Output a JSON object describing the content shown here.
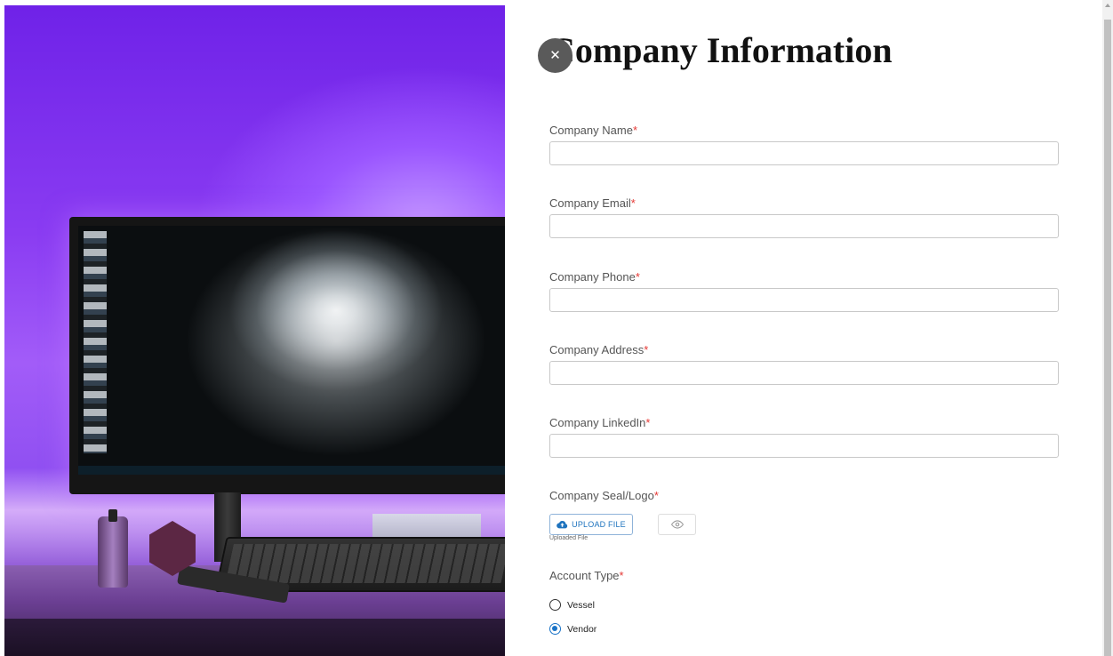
{
  "form": {
    "title": "Company Information",
    "close_icon": "close-icon",
    "required_mark": "*",
    "fields": [
      {
        "label": "Company Name",
        "value": "",
        "placeholder": ""
      },
      {
        "label": "Company Email",
        "value": "",
        "placeholder": ""
      },
      {
        "label": "Company Phone",
        "value": "",
        "placeholder": ""
      },
      {
        "label": "Company Address",
        "value": "",
        "placeholder": ""
      },
      {
        "label": "Company LinkedIn",
        "value": "",
        "placeholder": ""
      }
    ],
    "logo": {
      "label": "Company Seal/Logo",
      "upload_label": "UPLOAD FILE",
      "upload_icon": "cloud-upload-icon",
      "preview_icon": "eye-icon",
      "uploaded_note": "Uploaded File"
    },
    "account_type": {
      "label": "Account Type",
      "options": [
        "Vessel",
        "Vendor"
      ],
      "selected": "Vendor"
    }
  },
  "colors": {
    "accent": "#1a73c7",
    "required": "#e53935",
    "close_button": "#5a5a5a"
  }
}
